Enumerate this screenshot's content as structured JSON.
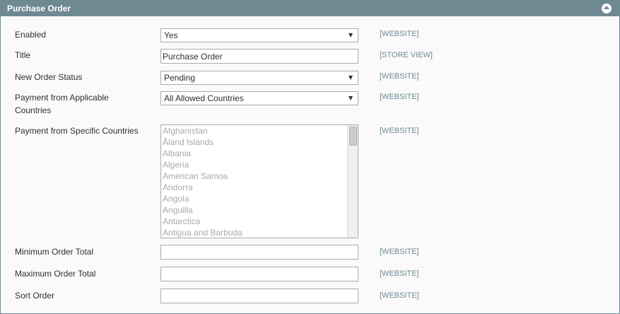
{
  "header": {
    "title": "Purchase Order"
  },
  "fields": {
    "enabled": {
      "label": "Enabled",
      "value": "Yes",
      "scope": "[WEBSITE]"
    },
    "title": {
      "label": "Title",
      "value": "Purchase Order",
      "scope": "[STORE VIEW]"
    },
    "new_order_status": {
      "label": "New Order Status",
      "value": "Pending",
      "scope": "[WEBSITE]"
    },
    "applicable_countries": {
      "label_line1": "Payment from Applicable",
      "label_line2": "Countries",
      "value": "All Allowed Countries",
      "scope": "[WEBSITE]"
    },
    "specific_countries": {
      "label": "Payment from Specific Countries",
      "scope": "[WEBSITE]",
      "options": [
        "Afghanistan",
        "Åland Islands",
        "Albania",
        "Algeria",
        "American Samoa",
        "Andorra",
        "Angola",
        "Anguilla",
        "Antarctica",
        "Antigua and Barbuda"
      ]
    },
    "min_order_total": {
      "label": "Minimum Order Total",
      "value": "",
      "scope": "[WEBSITE]"
    },
    "max_order_total": {
      "label": "Maximum Order Total",
      "value": "",
      "scope": "[WEBSITE]"
    },
    "sort_order": {
      "label": "Sort Order",
      "value": "",
      "scope": "[WEBSITE]"
    }
  }
}
